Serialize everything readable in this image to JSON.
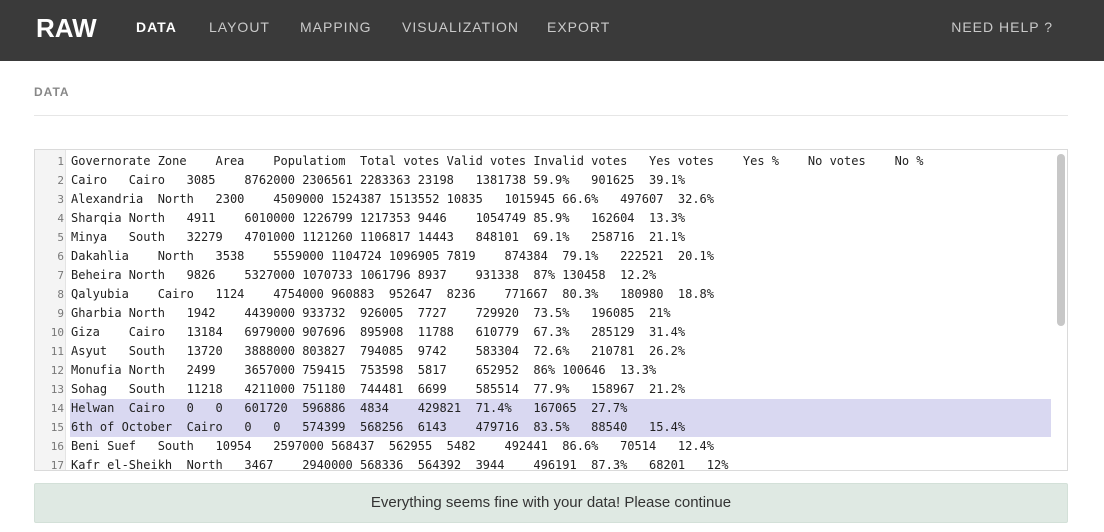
{
  "app": {
    "brand": "RAW",
    "help_label": "NEED HELP ?"
  },
  "nav": [
    {
      "label": "DATA",
      "active": true
    },
    {
      "label": "LAYOUT",
      "active": false
    },
    {
      "label": "MAPPING",
      "active": false
    },
    {
      "label": "VISUALIZATION",
      "active": false
    },
    {
      "label": "EXPORT",
      "active": false
    }
  ],
  "section": {
    "title": "DATA"
  },
  "editor": {
    "selected_lines": [
      14,
      15
    ],
    "lines": [
      {
        "n": "1",
        "text": "Governorate Zone    Area    Populatiom  Total votes Valid votes Invalid votes   Yes votes    Yes %    No votes    No %"
      },
      {
        "n": "2",
        "text": "Cairo   Cairo   3085    8762000 2306561 2283363 23198   1381738 59.9%   901625  39.1%"
      },
      {
        "n": "3",
        "text": "Alexandria  North   2300    4509000 1524387 1513552 10835   1015945 66.6%   497607  32.6%"
      },
      {
        "n": "4",
        "text": "Sharqia North   4911    6010000 1226799 1217353 9446    1054749 85.9%   162604  13.3%"
      },
      {
        "n": "5",
        "text": "Minya   South   32279   4701000 1121260 1106817 14443   848101  69.1%   258716  21.1%"
      },
      {
        "n": "6",
        "text": "Dakahlia    North   3538    5559000 1104724 1096905 7819    874384  79.1%   222521  20.1%"
      },
      {
        "n": "7",
        "text": "Beheira North   9826    5327000 1070733 1061796 8937    931338  87% 130458  12.2%"
      },
      {
        "n": "8",
        "text": "Qalyubia    Cairo   1124    4754000 960883  952647  8236    771667  80.3%   180980  18.8%"
      },
      {
        "n": "9",
        "text": "Gharbia North   1942    4439000 933732  926005  7727    729920  73.5%   196085  21%"
      },
      {
        "n": "10",
        "text": "Giza    Cairo   13184   6979000 907696  895908  11788   610779  67.3%   285129  31.4%"
      },
      {
        "n": "11",
        "text": "Asyut   South   13720   3888000 803827  794085  9742    583304  72.6%   210781  26.2%"
      },
      {
        "n": "12",
        "text": "Monufia North   2499    3657000 759415  753598  5817    652952  86% 100646  13.3%"
      },
      {
        "n": "13",
        "text": "Sohag   South   11218   4211000 751180  744481  6699    585514  77.9%   158967  21.2%"
      },
      {
        "n": "14",
        "text": "Helwan  Cairo   0   0   601720  596886  4834    429821  71.4%   167065  27.7%"
      },
      {
        "n": "15",
        "text": "6th of October  Cairo   0   0   574399  568256  6143    479716  83.5%   88540   15.4%"
      },
      {
        "n": "16",
        "text": "Beni Suef   South   10954   2597000 568437  562955  5482    492441  86.6%   70514   12.4%"
      },
      {
        "n": "17",
        "text": "Kafr el-Sheikh  North   3467    2940000 568336  564392  3944    496191  87.3%   68201   12%"
      }
    ]
  },
  "status": {
    "message": "Everything seems fine with your data! Please continue"
  }
}
